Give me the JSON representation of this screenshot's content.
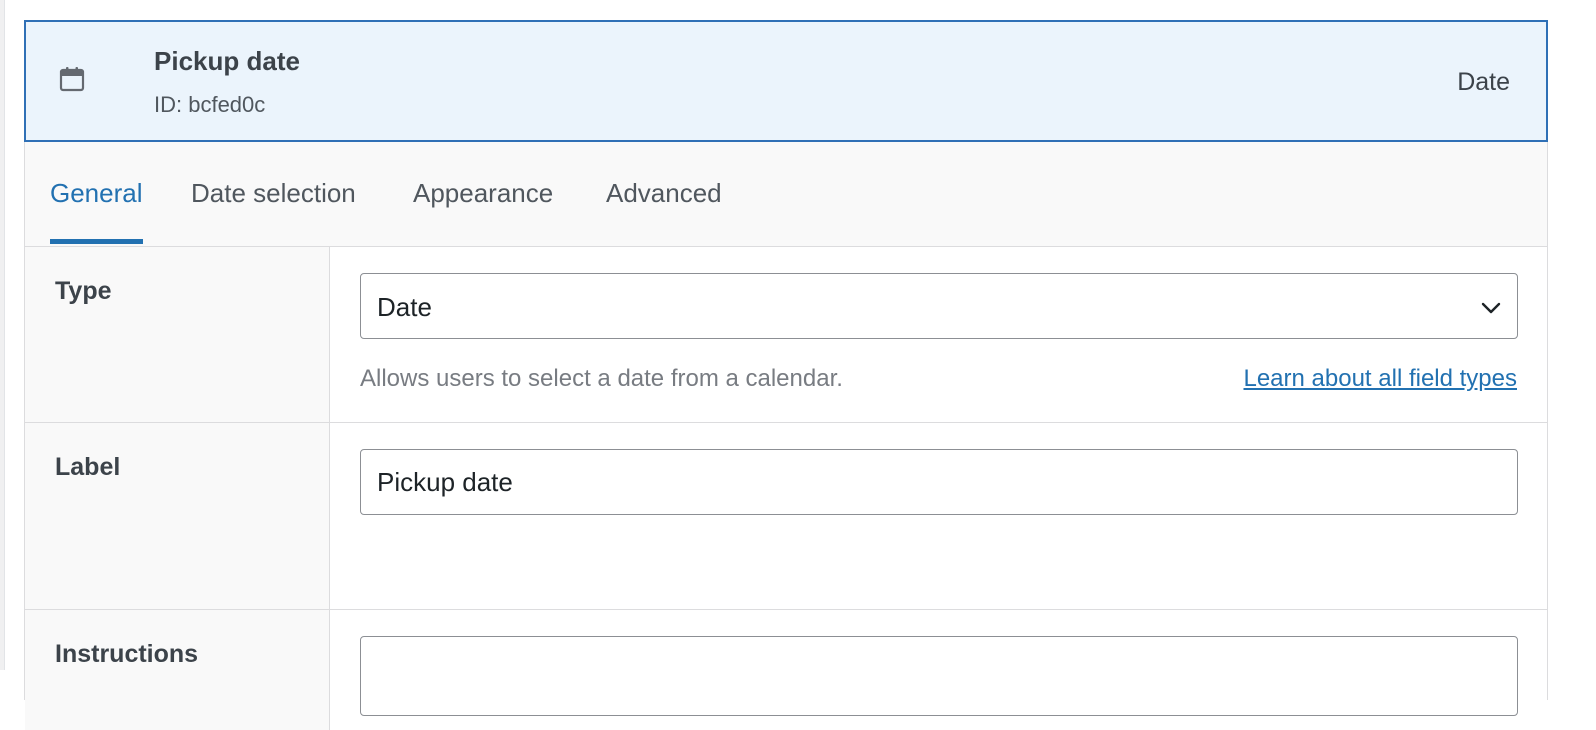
{
  "field": {
    "title": "Pickup date",
    "id_text": "ID: bcfed0c",
    "type_tag": "Date",
    "icon": "calendar-icon"
  },
  "tabs": [
    {
      "label": "General",
      "active": true
    },
    {
      "label": "Date selection",
      "active": false
    },
    {
      "label": "Appearance",
      "active": false
    },
    {
      "label": "Advanced",
      "active": false
    }
  ],
  "rows": {
    "type": {
      "label": "Type",
      "selected": "Date",
      "help": "Allows users to select a date from a calendar.",
      "link": "Learn about all field types"
    },
    "label": {
      "label": "Label",
      "value": "Pickup date"
    },
    "instructions": {
      "label": "Instructions"
    }
  },
  "colors": {
    "accent": "#2271b1",
    "header_bg": "#ebf4fc",
    "header_border": "#2f70b6"
  }
}
